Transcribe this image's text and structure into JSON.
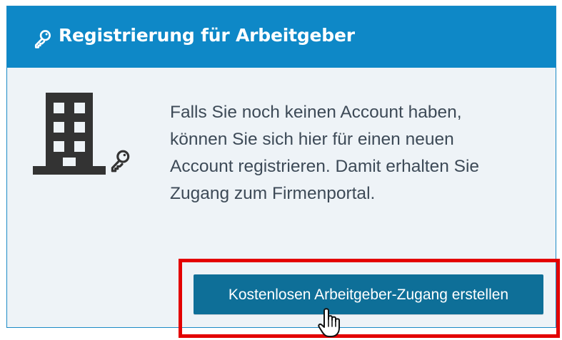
{
  "card": {
    "title": "Registrierung für Arbeitgeber",
    "description_lines": [
      "Falls Sie noch keinen Account haben,",
      "können Sie sich hier für einen neuen",
      "Account registrieren. Damit erhalten Sie",
      "Zugang zum Firmenportal."
    ],
    "button_label": "Kostenlosen Arbeitgeber-Zugang erstellen"
  },
  "icons": {
    "header": "key-icon",
    "building": "building-icon",
    "building_key": "key-icon",
    "cursor": "hand-cursor-icon"
  },
  "colors": {
    "header_background": "#0e88c7",
    "card_background": "#eef3f7",
    "button_background": "#0e6f98",
    "highlight_border": "#e30000",
    "text": "#3d4a57"
  }
}
